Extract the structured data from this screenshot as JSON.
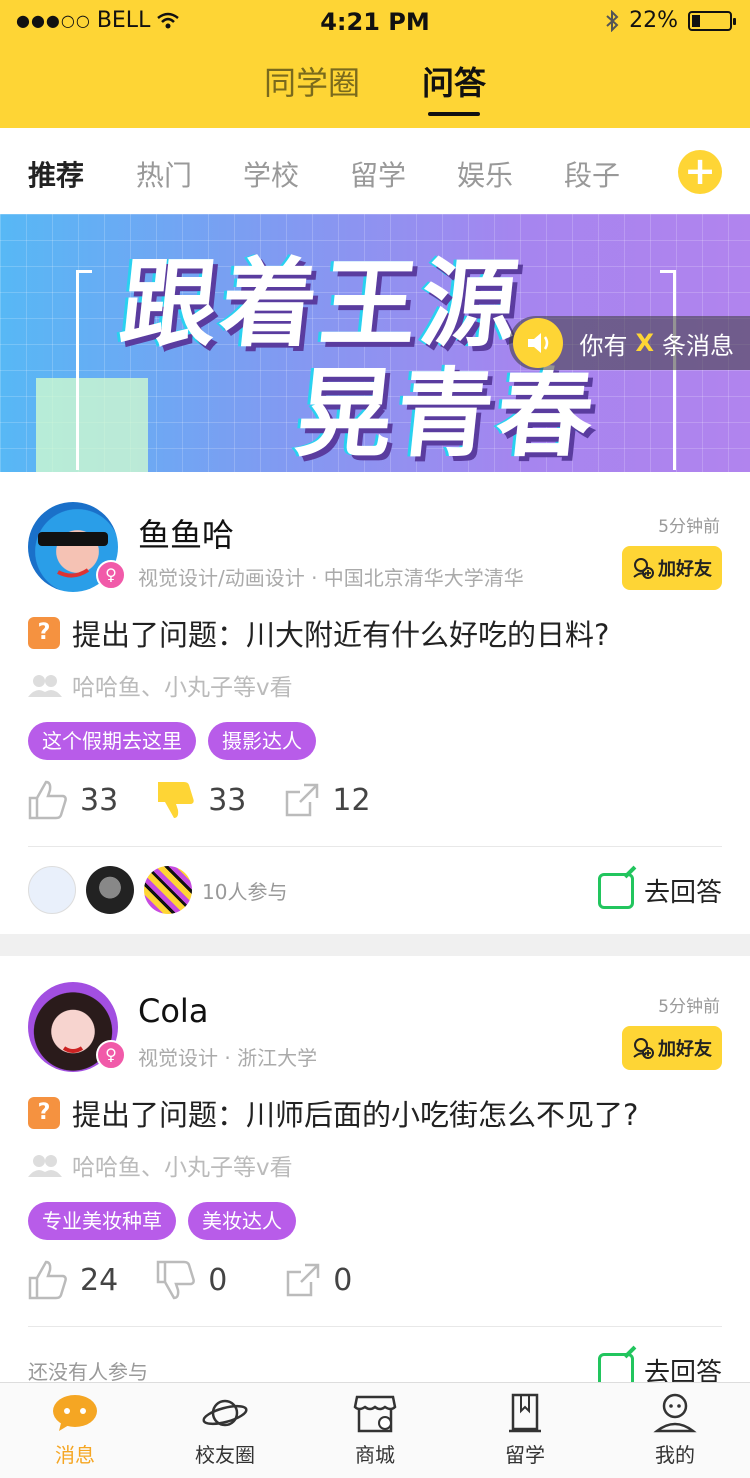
{
  "status_bar": {
    "carrier": "BELL",
    "time": "4:21 PM",
    "battery_text": "22%",
    "battery_level": 0.22
  },
  "top_tabs": [
    {
      "label": "同学圈",
      "active": false
    },
    {
      "label": "问答",
      "active": true
    }
  ],
  "categories": [
    {
      "label": "推荐",
      "active": true
    },
    {
      "label": "热门",
      "active": false
    },
    {
      "label": "学校",
      "active": false
    },
    {
      "label": "留学",
      "active": false
    },
    {
      "label": "娱乐",
      "active": false
    },
    {
      "label": "段子",
      "active": false
    }
  ],
  "banner": {
    "line1": "跟着王源",
    "line2": "晃青春",
    "msg_prefix": "你有",
    "msg_x": "X",
    "msg_suffix": "条消息"
  },
  "posts": [
    {
      "username": "鱼鱼哈",
      "meta": "视觉设计/动画设计 · 中国北京清华大学清华",
      "time": "5分钟前",
      "add_friend": "加好友",
      "question": "提出了问题：川大附近有什么好吃的日料?",
      "viewers": "哈哈鱼、小丸子等v看",
      "tags": [
        "这个假期去这里",
        "摄影达人"
      ],
      "likes": "33",
      "dislikes": "33",
      "shares": "12",
      "participants": "10人参与",
      "answer": "去回答"
    },
    {
      "username": "Cola",
      "meta": "视觉设计 · 浙江大学",
      "time": "5分钟前",
      "add_friend": "加好友",
      "question": "提出了问题：川师后面的小吃街怎么不见了?",
      "viewers": "哈哈鱼、小丸子等v看",
      "tags": [
        "专业美妆种草",
        "美妆达人"
      ],
      "likes": "24",
      "dislikes": "0",
      "shares": "0",
      "participants": "还没有人参与",
      "answer": "去回答"
    }
  ],
  "bottom_nav": [
    {
      "label": "消息",
      "icon": "message-icon",
      "active": true
    },
    {
      "label": "校友圈",
      "icon": "planet-icon",
      "active": false
    },
    {
      "label": "商城",
      "icon": "store-icon",
      "active": false
    },
    {
      "label": "留学",
      "icon": "book-icon",
      "active": false
    },
    {
      "label": "我的",
      "icon": "profile-icon",
      "active": false
    }
  ],
  "colors": {
    "brand_yellow": "#FED535",
    "tag_purple": "#B85CE9",
    "answer_green": "#22C55E",
    "question_orange": "#F59240"
  }
}
